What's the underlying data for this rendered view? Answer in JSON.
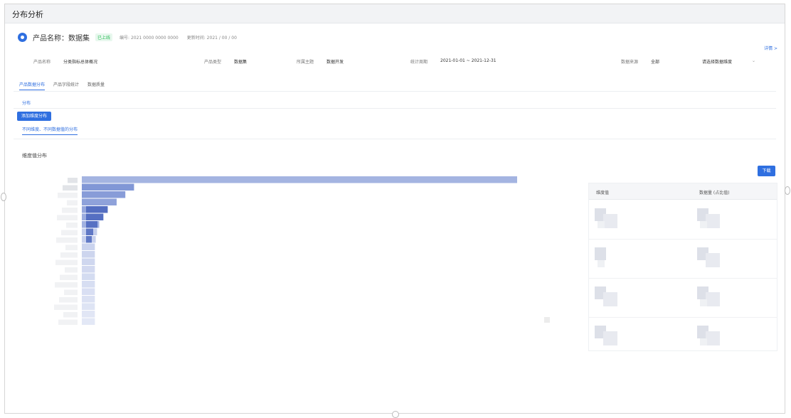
{
  "window": {
    "title": "分布分析"
  },
  "header": {
    "product_name": "产品名称：数据集",
    "status_badge": "已上线",
    "meta_1": "编号: 2021 0000 0000 0000",
    "meta_2": "更新时间: 2021 / 00 / 00"
  },
  "more_link": "详情 >",
  "info_row": {
    "label_1": "产品名称",
    "value_1": "分类指标总体概况",
    "label_2": "产品类型",
    "value_2": "数据集",
    "label_3": "所属主题",
    "value_3": "数据开发",
    "label_4": "统计周期",
    "value_4": "2021-01-01 ~ 2021-12-31",
    "label_5": "数据来源",
    "value_5": "全部",
    "select_value": "请选择数据维度"
  },
  "tabs": [
    {
      "label": "产品数据分布"
    },
    {
      "label": "产品字段统计"
    },
    {
      "label": "数据质量"
    }
  ],
  "sub_tab": "分布",
  "primary_button": "添加维度分布",
  "hint_link": "不同维度、不同数据值的分布",
  "section_title": "维度值分布",
  "download_button": "下载",
  "table": {
    "col_1": "维度值",
    "col_2": "数据量 (占比值)"
  },
  "chart_data": {
    "type": "bar",
    "orientation": "horizontal",
    "legend": "none",
    "bar_color": "#5a76c9",
    "rows": [
      {
        "value": 100
      },
      {
        "value": 12
      },
      {
        "value": 10
      },
      {
        "value": 8
      },
      {
        "value": 6
      },
      {
        "value": 5
      },
      {
        "value": 4
      },
      {
        "value": 3.5
      },
      {
        "value": 3.2
      },
      {
        "value": 3
      },
      {
        "value": 3
      },
      {
        "value": 3
      },
      {
        "value": 3
      },
      {
        "value": 3
      },
      {
        "value": 3
      },
      {
        "value": 3
      },
      {
        "value": 3
      },
      {
        "value": 3
      },
      {
        "value": 3
      },
      {
        "value": 3
      }
    ]
  }
}
